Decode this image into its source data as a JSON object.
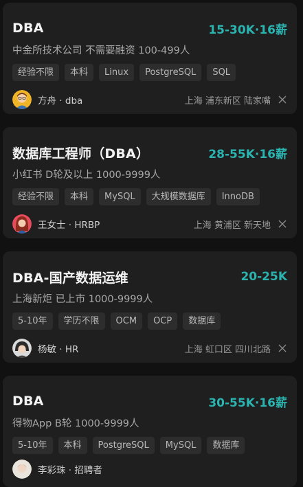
{
  "jobs": [
    {
      "title": "DBA",
      "salary": "15-30K·16薪",
      "company": "中金所技术公司 不需要融资 100-499人",
      "tags": [
        "经验不限",
        "本科",
        "Linux",
        "PostgreSQL",
        "SQL"
      ],
      "recruiter": "方舟 · dba",
      "location": "上海 浦东新区 陆家嘴"
    },
    {
      "title": "数据库工程师（DBA）",
      "salary": "28-55K·16薪",
      "company": "小红书 D轮及以上 1000-9999人",
      "tags": [
        "经验不限",
        "本科",
        "MySQL",
        "大规模数据库",
        "InnoDB"
      ],
      "recruiter": "王女士 · HRBP",
      "location": "上海 黄浦区 新天地"
    },
    {
      "title": "DBA-国产数据运维",
      "salary": "20-25K",
      "company": "上海新炬 已上市 1000-9999人",
      "tags": [
        "5-10年",
        "学历不限",
        "OCM",
        "OCP",
        "数据库"
      ],
      "recruiter": "杨敏 · HR",
      "location": "上海 虹口区 四川北路"
    },
    {
      "title": "DBA",
      "salary": "30-55K·16薪",
      "company": "得物App B轮 1000-9999人",
      "tags": [
        "5-10年",
        "本科",
        "PostgreSQL",
        "MySQL",
        "数据库"
      ],
      "recruiter": "李彩珠 · 招聘者",
      "location": ""
    }
  ],
  "colors": {
    "background": "#111111",
    "card": "#1f1f1f",
    "salary": "#2bb3b0",
    "tag_bg": "#2d2d2d"
  }
}
